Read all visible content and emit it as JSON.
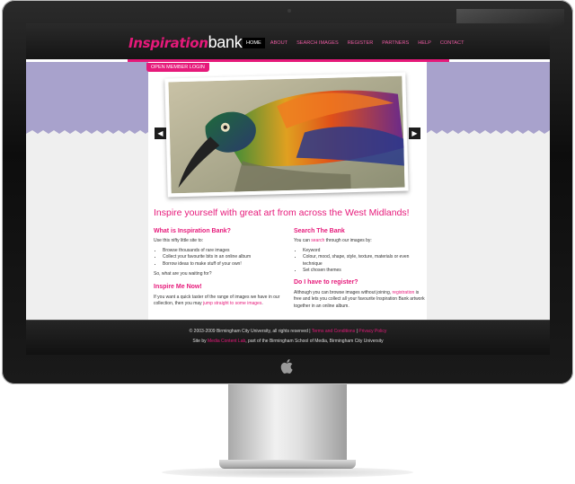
{
  "site": {
    "logo_part1": "Inspiration",
    "logo_part2": "bank",
    "nav": [
      "HOME",
      "ABOUT",
      "SEARCH IMAGES",
      "REGISTER",
      "PARTNERS",
      "HELP",
      "CONTACT"
    ],
    "member_login": "OPEN MEMBER LOGIN",
    "prev_arrow": "◀",
    "next_arrow": "▶",
    "tagline": "Inspire yourself with great art from across the West Midlands!"
  },
  "what_is": {
    "heading": "What is Inspiration Bank?",
    "intro": "Use this nifty little site to:",
    "items": [
      "Browse thousands of rare images",
      "Collect your favourite bits in an online album",
      "Borrow ideas to make stuff of your own!"
    ],
    "outro": "So, what are you waiting for?"
  },
  "inspire_me": {
    "heading": "Inspire Me Now!",
    "text_before": "If you want a quick taster of the range of images we have in our collection, then you may ",
    "link": "jump straight to some images",
    "text_after": "."
  },
  "search_bank": {
    "heading": "Search The Bank",
    "text_before": "You can ",
    "link": "search",
    "text_after": " through our images by:",
    "items": [
      "Keyword",
      "Colour, mood, shape, style, texture, materials or even technique",
      "Set chosen themes"
    ]
  },
  "register": {
    "heading": "Do I have to register?",
    "text_before": "Although you can browse images without joining, ",
    "link": "registration",
    "text_after": " is free and lets you collect all your favourite Inspiration Bank artwork together in an online album."
  },
  "footer": {
    "copyright": "© 2003-2009 Birmingham City University, all rights reserved | ",
    "terms_link": "Terms and Conditions",
    "separator": " | ",
    "privacy_link": "Privacy Policy",
    "site_by": "Site by ",
    "mcl_link": "Media Content Lab",
    "site_by_after": ", part of the Birmingham School of Media, Birmingham City University"
  },
  "colors": {
    "accent": "#e6197a",
    "band": "#a8a2cc",
    "header": "#1a1a1a"
  }
}
